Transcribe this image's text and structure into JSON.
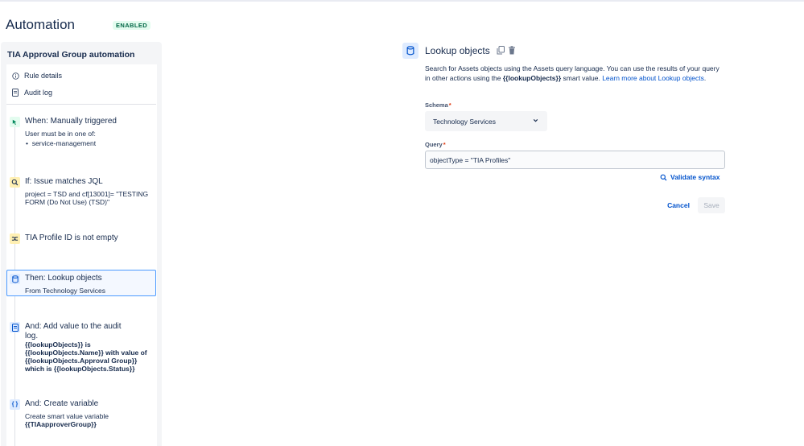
{
  "header": {
    "title": "Automation",
    "status": "ENABLED"
  },
  "sidebar": {
    "rule_name": "TIA Approval Group automation",
    "nav": [
      {
        "label": "Rule details",
        "icon": "info-icon"
      },
      {
        "label": "Audit log",
        "icon": "document-icon"
      }
    ],
    "components": [
      {
        "icon": "trigger-icon",
        "title": "When: Manually triggered",
        "lines": [
          "User must be in one of:"
        ],
        "bullets": [
          "service-management"
        ]
      },
      {
        "icon": "search-icon",
        "title": "If: Issue matches JQL",
        "lines": [
          "project = TSD and cf[13001]= \"TESTING",
          "FORM (Do Not Use) (TSD)\""
        ]
      },
      {
        "icon": "branch-icon",
        "title": "TIA Profile ID is not empty",
        "lines": []
      },
      {
        "icon": "database-icon",
        "title": "Then: Lookup objects",
        "lines": [
          "From Technology Services"
        ]
      },
      {
        "icon": "log-icon",
        "title_lines": [
          "And: Add value to the audit",
          "log."
        ],
        "bold_lines": [
          "{{lookupObjects}} is",
          "{{lookupObjects.Name}} with value of",
          "{{lookupObjects.Approval Group}}",
          "which is {{lookupObjects.Status}}"
        ]
      },
      {
        "icon": "braces-icon",
        "title": "And: Create variable",
        "lines": [
          "Create smart value variable"
        ],
        "bold_lines": [
          "{{TIAapproverGroup}}"
        ]
      }
    ]
  },
  "panel": {
    "title": "Lookup objects",
    "desc_part1": "Search for Assets objects using the Assets query language. You can use the results of your query in other actions using the ",
    "desc_bold": "{{lookupObjects}}",
    "desc_part2": " smart value. ",
    "desc_link": "Learn more about Lookup objects",
    "desc_end": ".",
    "schema_label": "Schema",
    "schema_value": "Technology Services",
    "query_label": "Query",
    "query_value": "objectType = \"TIA Profiles\"",
    "validate_label": "Validate syntax",
    "cancel_label": "Cancel",
    "save_label": "Save",
    "required_mark": "*"
  },
  "colors": {
    "accent": "#0052cc",
    "selected_border": "#4c9aff",
    "enabled_bg": "#e3fcef",
    "enabled_text": "#006644",
    "trigger_icon_bg": "#e3fcef",
    "condition_icon_bg": "#fff0b3",
    "action_icon_bg": "#deebff"
  }
}
